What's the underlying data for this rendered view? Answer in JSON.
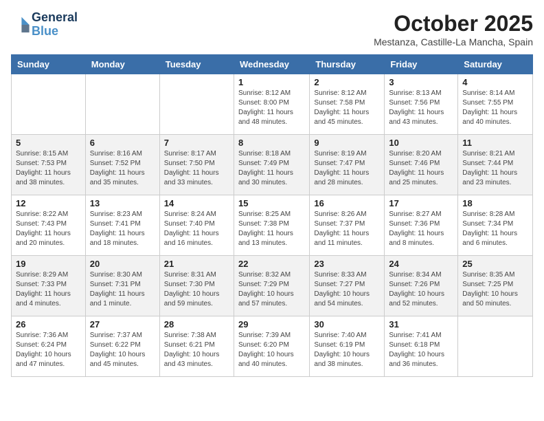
{
  "header": {
    "logo_line1": "General",
    "logo_line2": "Blue",
    "month_title": "October 2025",
    "location": "Mestanza, Castille-La Mancha, Spain"
  },
  "weekdays": [
    "Sunday",
    "Monday",
    "Tuesday",
    "Wednesday",
    "Thursday",
    "Friday",
    "Saturday"
  ],
  "weeks": [
    [
      {
        "day": "",
        "info": ""
      },
      {
        "day": "",
        "info": ""
      },
      {
        "day": "",
        "info": ""
      },
      {
        "day": "1",
        "info": "Sunrise: 8:12 AM\nSunset: 8:00 PM\nDaylight: 11 hours and 48 minutes."
      },
      {
        "day": "2",
        "info": "Sunrise: 8:12 AM\nSunset: 7:58 PM\nDaylight: 11 hours and 45 minutes."
      },
      {
        "day": "3",
        "info": "Sunrise: 8:13 AM\nSunset: 7:56 PM\nDaylight: 11 hours and 43 minutes."
      },
      {
        "day": "4",
        "info": "Sunrise: 8:14 AM\nSunset: 7:55 PM\nDaylight: 11 hours and 40 minutes."
      }
    ],
    [
      {
        "day": "5",
        "info": "Sunrise: 8:15 AM\nSunset: 7:53 PM\nDaylight: 11 hours and 38 minutes."
      },
      {
        "day": "6",
        "info": "Sunrise: 8:16 AM\nSunset: 7:52 PM\nDaylight: 11 hours and 35 minutes."
      },
      {
        "day": "7",
        "info": "Sunrise: 8:17 AM\nSunset: 7:50 PM\nDaylight: 11 hours and 33 minutes."
      },
      {
        "day": "8",
        "info": "Sunrise: 8:18 AM\nSunset: 7:49 PM\nDaylight: 11 hours and 30 minutes."
      },
      {
        "day": "9",
        "info": "Sunrise: 8:19 AM\nSunset: 7:47 PM\nDaylight: 11 hours and 28 minutes."
      },
      {
        "day": "10",
        "info": "Sunrise: 8:20 AM\nSunset: 7:46 PM\nDaylight: 11 hours and 25 minutes."
      },
      {
        "day": "11",
        "info": "Sunrise: 8:21 AM\nSunset: 7:44 PM\nDaylight: 11 hours and 23 minutes."
      }
    ],
    [
      {
        "day": "12",
        "info": "Sunrise: 8:22 AM\nSunset: 7:43 PM\nDaylight: 11 hours and 20 minutes."
      },
      {
        "day": "13",
        "info": "Sunrise: 8:23 AM\nSunset: 7:41 PM\nDaylight: 11 hours and 18 minutes."
      },
      {
        "day": "14",
        "info": "Sunrise: 8:24 AM\nSunset: 7:40 PM\nDaylight: 11 hours and 16 minutes."
      },
      {
        "day": "15",
        "info": "Sunrise: 8:25 AM\nSunset: 7:38 PM\nDaylight: 11 hours and 13 minutes."
      },
      {
        "day": "16",
        "info": "Sunrise: 8:26 AM\nSunset: 7:37 PM\nDaylight: 11 hours and 11 minutes."
      },
      {
        "day": "17",
        "info": "Sunrise: 8:27 AM\nSunset: 7:36 PM\nDaylight: 11 hours and 8 minutes."
      },
      {
        "day": "18",
        "info": "Sunrise: 8:28 AM\nSunset: 7:34 PM\nDaylight: 11 hours and 6 minutes."
      }
    ],
    [
      {
        "day": "19",
        "info": "Sunrise: 8:29 AM\nSunset: 7:33 PM\nDaylight: 11 hours and 4 minutes."
      },
      {
        "day": "20",
        "info": "Sunrise: 8:30 AM\nSunset: 7:31 PM\nDaylight: 11 hours and 1 minute."
      },
      {
        "day": "21",
        "info": "Sunrise: 8:31 AM\nSunset: 7:30 PM\nDaylight: 10 hours and 59 minutes."
      },
      {
        "day": "22",
        "info": "Sunrise: 8:32 AM\nSunset: 7:29 PM\nDaylight: 10 hours and 57 minutes."
      },
      {
        "day": "23",
        "info": "Sunrise: 8:33 AM\nSunset: 7:27 PM\nDaylight: 10 hours and 54 minutes."
      },
      {
        "day": "24",
        "info": "Sunrise: 8:34 AM\nSunset: 7:26 PM\nDaylight: 10 hours and 52 minutes."
      },
      {
        "day": "25",
        "info": "Sunrise: 8:35 AM\nSunset: 7:25 PM\nDaylight: 10 hours and 50 minutes."
      }
    ],
    [
      {
        "day": "26",
        "info": "Sunrise: 7:36 AM\nSunset: 6:24 PM\nDaylight: 10 hours and 47 minutes."
      },
      {
        "day": "27",
        "info": "Sunrise: 7:37 AM\nSunset: 6:22 PM\nDaylight: 10 hours and 45 minutes."
      },
      {
        "day": "28",
        "info": "Sunrise: 7:38 AM\nSunset: 6:21 PM\nDaylight: 10 hours and 43 minutes."
      },
      {
        "day": "29",
        "info": "Sunrise: 7:39 AM\nSunset: 6:20 PM\nDaylight: 10 hours and 40 minutes."
      },
      {
        "day": "30",
        "info": "Sunrise: 7:40 AM\nSunset: 6:19 PM\nDaylight: 10 hours and 38 minutes."
      },
      {
        "day": "31",
        "info": "Sunrise: 7:41 AM\nSunset: 6:18 PM\nDaylight: 10 hours and 36 minutes."
      },
      {
        "day": "",
        "info": ""
      }
    ]
  ]
}
